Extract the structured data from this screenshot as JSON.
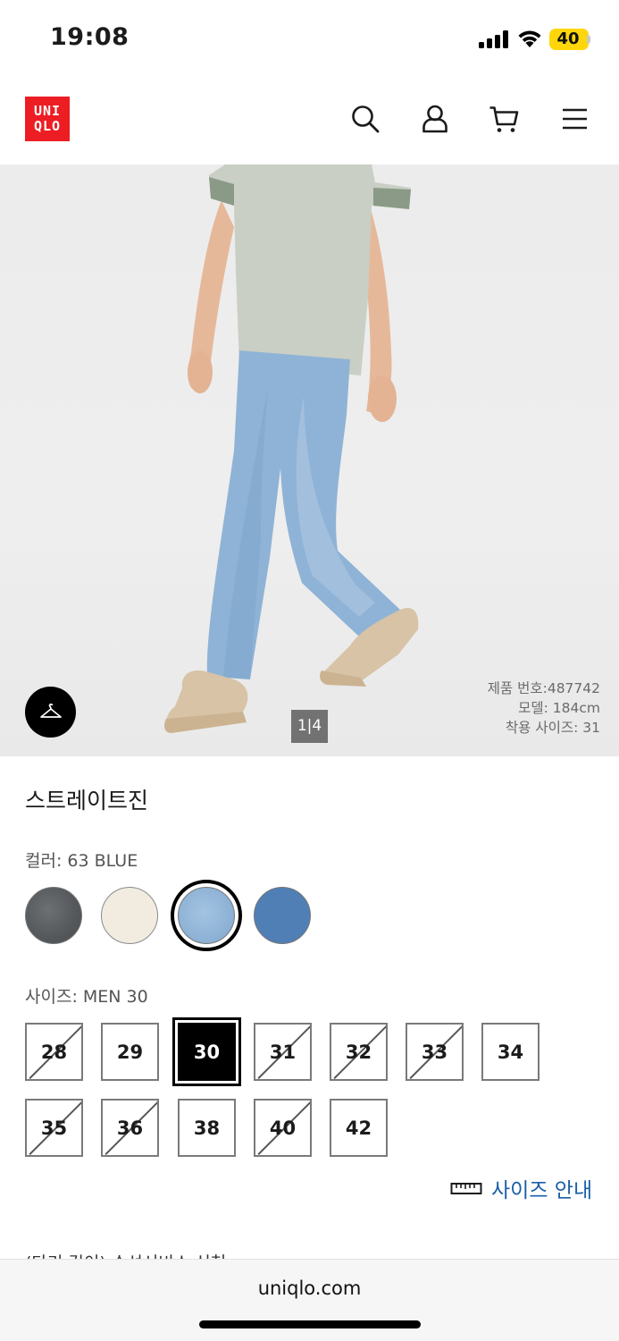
{
  "status_bar": {
    "time": "19:08",
    "battery_level": "40",
    "icons": [
      "cellular-signal-icon",
      "wifi-icon",
      "battery-icon"
    ]
  },
  "header": {
    "logo_line1": "UNI",
    "logo_line2": "QLO",
    "icons": [
      "search-icon",
      "account-icon",
      "cart-icon",
      "menu-icon"
    ],
    "brand_color": "#ed1d24"
  },
  "hero": {
    "pager": "1|4",
    "product_number": "제품 번호:487742",
    "model_height": "모델: 184cm",
    "model_size": "착용 사이즈: 31",
    "hanger_icon": "hanger-icon"
  },
  "product": {
    "name": "스트레이트진",
    "color_label": "컬러: 63 BLUE",
    "colors": [
      {
        "name": "gray",
        "hex": "#5c5f62",
        "selected": false
      },
      {
        "name": "off-white",
        "hex": "#f1ecdf",
        "selected": false
      },
      {
        "name": "light-blue",
        "hex": "#8fb3d6",
        "selected": true
      },
      {
        "name": "blue",
        "hex": "#4f7fb5",
        "selected": false
      }
    ],
    "size_label": "사이즈: MEN 30",
    "sizes": [
      {
        "label": "28",
        "available": false,
        "selected": false
      },
      {
        "label": "29",
        "available": true,
        "selected": false
      },
      {
        "label": "30",
        "available": true,
        "selected": true
      },
      {
        "label": "31",
        "available": false,
        "selected": false
      },
      {
        "label": "32",
        "available": false,
        "selected": false
      },
      {
        "label": "33",
        "available": false,
        "selected": false
      },
      {
        "label": "34",
        "available": true,
        "selected": false
      },
      {
        "label": "35",
        "available": false,
        "selected": false
      },
      {
        "label": "36",
        "available": false,
        "selected": false
      },
      {
        "label": "38",
        "available": true,
        "selected": false
      },
      {
        "label": "40",
        "available": false,
        "selected": false
      },
      {
        "label": "42",
        "available": true,
        "selected": false
      }
    ],
    "size_guide": "사이즈 안내",
    "size_guide_icon": "ruler-icon",
    "cut_text": "(다리 길이) 수선서비스 신청"
  },
  "browser": {
    "url": "uniqlo.com"
  }
}
